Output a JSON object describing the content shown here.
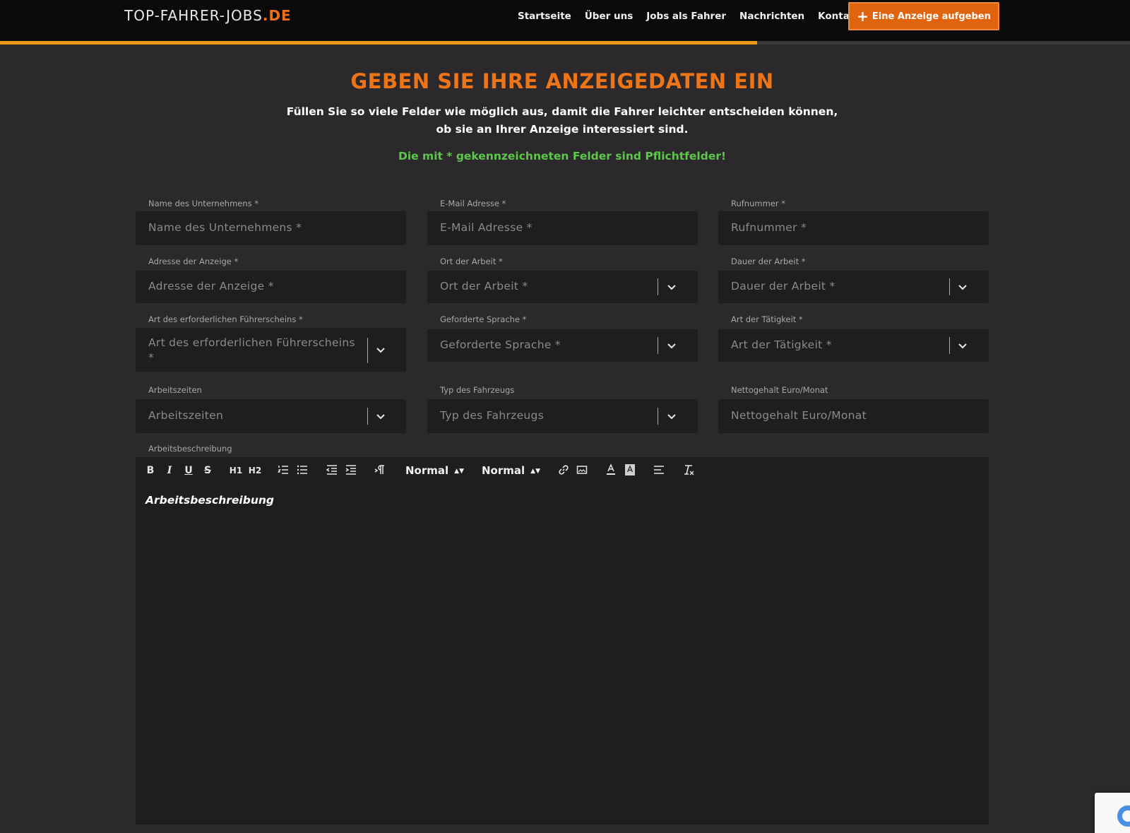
{
  "header": {
    "logo_main": "TOP-FAHRER-JOBS",
    "logo_tld": ".DE",
    "nav": [
      "Startseite",
      "Über uns",
      "Jobs als Fahrer",
      "Nachrichten",
      "Kontakt"
    ],
    "cta_label": "Eine Anzeige aufgeben",
    "cta_icon": "plus-icon"
  },
  "progress": {
    "fraction": 0.67
  },
  "intro": {
    "title": "GEBEN SIE IHRE ANZEIGEDATEN EIN",
    "subtitle": "Füllen Sie so viele Felder wie möglich aus, damit die Fahrer leichter entscheiden können, ob sie an Ihrer Anzeige interessiert sind.",
    "required_note": "Die mit * gekennzeichneten Felder sind Pflichtfelder!"
  },
  "fields": {
    "company": {
      "label": "Name des Unternehmens *",
      "placeholder": "Name des Unternehmens *"
    },
    "email": {
      "label": "E-Mail Adresse *",
      "placeholder": "E-Mail Adresse *"
    },
    "phone": {
      "label": "Rufnummer *",
      "placeholder": "Rufnummer *"
    },
    "address": {
      "label": "Adresse der Anzeige *",
      "placeholder": "Adresse der Anzeige *"
    },
    "work_location": {
      "label": "Ort der Arbeit *",
      "placeholder": "Ort der Arbeit *"
    },
    "duration": {
      "label": "Dauer der Arbeit *",
      "placeholder": "Dauer der Arbeit *"
    },
    "license": {
      "label": "Art des erforderlichen Führerscheins *",
      "placeholder_line1": "Art des erforderlichen Führerscheins",
      "placeholder_line2": "*"
    },
    "language": {
      "label": "Geforderte Sprache *",
      "placeholder": "Geforderte Sprache *"
    },
    "activity": {
      "label": "Art der Tätigkeit *",
      "placeholder": "Art der Tätigkeit *"
    },
    "hours": {
      "label": "Arbeitszeiten",
      "placeholder": "Arbeitszeiten"
    },
    "vehicle": {
      "label": "Typ des Fahrzeugs",
      "placeholder": "Typ des Fahrzeugs"
    },
    "salary": {
      "label": "Nettogehalt Euro/Monat",
      "placeholder": "Nettogehalt Euro/Monat"
    }
  },
  "editor": {
    "label": "Arbeitsbeschreibung",
    "placeholder": "Arbeitsbeschreibung",
    "font_select": "Normal",
    "size_select": "Normal",
    "tools": {
      "bold": "B",
      "italic": "I",
      "underline": "U",
      "strike": "S",
      "h1": "H1",
      "h2": "H2"
    }
  },
  "colors": {
    "accent": "#ee7418",
    "required_green": "#5cc74a",
    "background": "#2b292b",
    "field_bg": "#1f1d1f"
  }
}
